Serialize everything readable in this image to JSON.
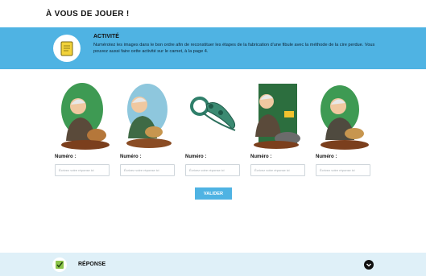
{
  "page": {
    "title": "À VOUS DE JOUER !"
  },
  "activity": {
    "title": "ACTIVITÉ",
    "text": "Numérotez les images dans le bon ordre afin de reconstituer les étapes de la fabrication d'une fibule avec la méthode de la cire perdue. Vous pouvez aussi faire cette activité sur le carnet, à la page 4.",
    "icon": "notebook-icon",
    "accent_color": "#4fb3e3"
  },
  "cards": [
    {
      "label": "Numéro :",
      "placeholder": "Écrivez votre réponse ici",
      "image": "craftsman-shaping-wax-illustration"
    },
    {
      "label": "Numéro :",
      "placeholder": "Écrivez votre réponse ici",
      "image": "craftsman-covering-mold-illustration"
    },
    {
      "label": "Numéro :",
      "placeholder": "Écrivez votre réponse ici",
      "image": "bronze-fibula-illustration"
    },
    {
      "label": "Numéro :",
      "placeholder": "Écrivez votre réponse ici",
      "image": "craftsman-pouring-metal-illustration"
    },
    {
      "label": "Numéro :",
      "placeholder": "Écrivez votre réponse ici",
      "image": "craftsman-breaking-mold-illustration"
    }
  ],
  "validate": {
    "label": "VALIDER"
  },
  "answer": {
    "title": "RÉPONSE",
    "icon": "checkmark-icon",
    "toggle_icon": "chevron-down-icon",
    "band_color": "#dff0f8"
  }
}
